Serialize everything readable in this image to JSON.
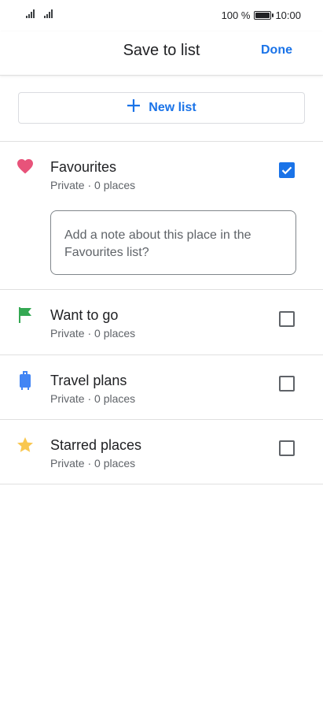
{
  "status_bar": {
    "battery_text": "100 %",
    "time": "10:00"
  },
  "header": {
    "title": "Save to list",
    "done_label": "Done"
  },
  "new_list": {
    "label": "New list",
    "icon": "plus-icon"
  },
  "colors": {
    "accent": "#1a73e8",
    "favourites_icon": "#e8537a",
    "want_to_go_icon": "#34a853",
    "travel_icon": "#4285f4",
    "starred_icon": "#f9c74f"
  },
  "lists": [
    {
      "name": "Favourites",
      "subtitle": "Private · 0 places",
      "icon": "heart-icon",
      "checked": true
    },
    {
      "name": "Want to go",
      "subtitle": "Private · 0 places",
      "icon": "flag-icon",
      "checked": false
    },
    {
      "name": "Travel plans",
      "subtitle": "Private · 0 places",
      "icon": "suitcase-icon",
      "checked": false
    },
    {
      "name": "Starred places",
      "subtitle": "Private · 0 places",
      "icon": "star-icon",
      "checked": false
    }
  ],
  "note": {
    "placeholder": "Add a note about this place in the Favourites list?"
  }
}
